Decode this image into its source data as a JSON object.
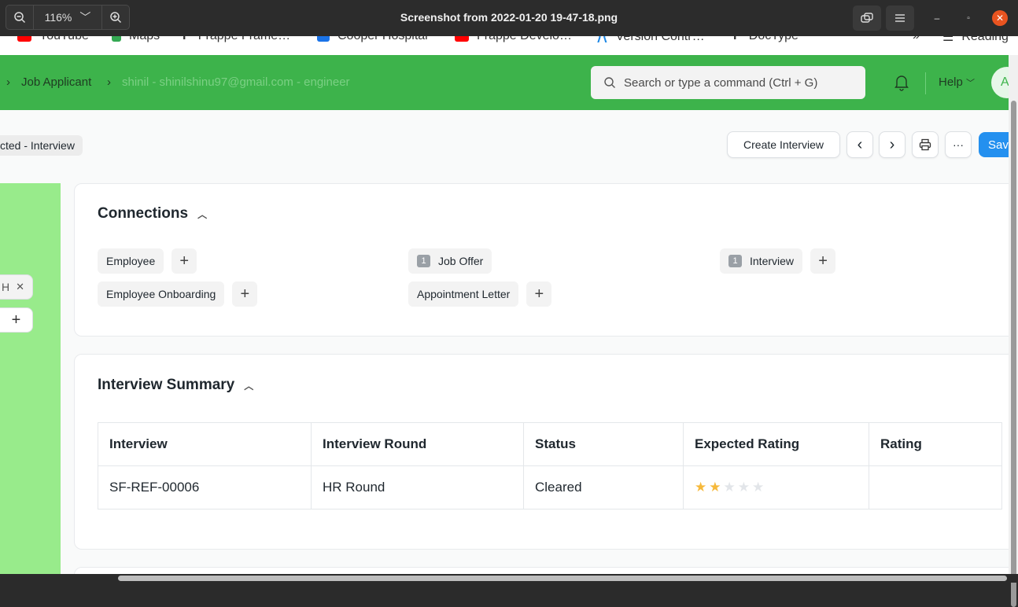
{
  "viewer": {
    "zoom": "116%",
    "title": "Screenshot from 2022-01-20 19-47-18.png"
  },
  "bookmarks": [
    {
      "label": "YouTube",
      "color": "#ff0000"
    },
    {
      "label": "Maps",
      "color": "#34a853"
    },
    {
      "label": "Frappe Frame…",
      "color": "#333333"
    },
    {
      "label": "Cooper Hospital",
      "color": "#1a73e8"
    },
    {
      "label": "Frappe Develo…",
      "color": "#ff0000"
    },
    {
      "label": "Version Contr…",
      "color": "#1e88e5"
    },
    {
      "label": "DocType",
      "color": "#333333"
    },
    {
      "label": "»",
      "color": ""
    },
    {
      "label": "Reading",
      "color": ""
    }
  ],
  "navbar": {
    "breadcrumb_sep": "›",
    "breadcrumb_doctype": "Job Applicant",
    "breadcrumb_doc": "shinil - shinilshinu97@gmail.com - engineer",
    "search_placeholder": "Search or type a command (Ctrl + G)",
    "help_label": "Help",
    "avatar_letter": "A",
    "accent": "#3db34b"
  },
  "page": {
    "status": "cted - Interview",
    "actions": {
      "create_interview": "Create Interview",
      "prev": "‹",
      "next": "›",
      "more": "···",
      "save": "Sav"
    },
    "sidebar": {
      "chip_text": "H",
      "chip_close": "✕",
      "plus": "+"
    }
  },
  "connections": {
    "title": "Connections",
    "items": [
      {
        "label": "Employee",
        "count": "",
        "has_add": true
      },
      {
        "label": "Employee Onboarding",
        "count": "",
        "has_add": true
      },
      {
        "label": "Job Offer",
        "count": "1",
        "has_add": false
      },
      {
        "label": "Appointment Letter",
        "count": "",
        "has_add": true
      },
      {
        "label": "Interview",
        "count": "1",
        "has_add": true
      }
    ]
  },
  "interview_summary": {
    "title": "Interview Summary",
    "columns": [
      "Interview",
      "Interview Round",
      "Status",
      "Expected Rating",
      "Rating"
    ],
    "rows": [
      {
        "interview": "SF-REF-00006",
        "round": "HR Round",
        "status": "Cleared",
        "expected_rating": 2,
        "expected_rating_max": 5,
        "rating": ""
      }
    ]
  }
}
